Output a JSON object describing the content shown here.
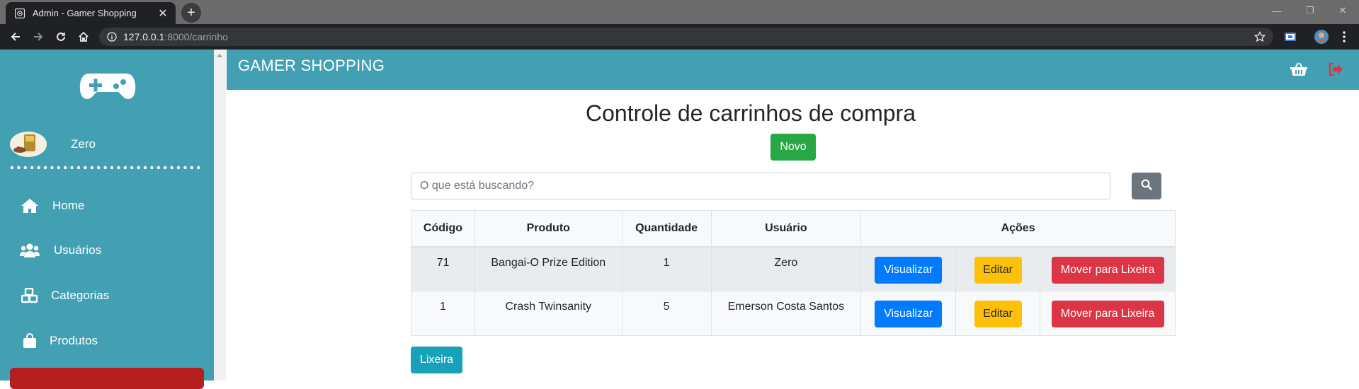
{
  "browser": {
    "tab_title": "Admin - Gamer Shopping",
    "tab_close": "✕",
    "new_tab": "+",
    "url_host": "127.0.0.1",
    "url_path": ":8000/carrinho",
    "window_controls": [
      "—",
      "❐",
      "✕"
    ]
  },
  "sidebar": {
    "logo_icon": "gamepad-icon",
    "username": "Zero",
    "items": [
      {
        "label": "Home",
        "icon": "home-icon"
      },
      {
        "label": "Usuários",
        "icon": "users-icon"
      },
      {
        "label": "Categorias",
        "icon": "categories-icon"
      },
      {
        "label": "Produtos",
        "icon": "shopping-bag-icon"
      }
    ]
  },
  "header": {
    "brand": "GAMER SHOPPING",
    "icons": [
      "basket-icon",
      "logout-icon"
    ]
  },
  "main": {
    "title": "Controle de carrinhos de compra",
    "new_button": "Novo",
    "search_placeholder": "O que está buscando?",
    "trash_button": "Lixeira",
    "table": {
      "headers": [
        "Código",
        "Produto",
        "Quantidade",
        "Usuário",
        "Ações"
      ],
      "rows": [
        {
          "codigo": "71",
          "produto": "Bangai-O Prize Edition",
          "quantidade": "1",
          "usuario": "Zero"
        },
        {
          "codigo": "1",
          "produto": "Crash Twinsanity",
          "quantidade": "5",
          "usuario": "Emerson Costa Santos"
        }
      ],
      "actions": {
        "view": "Visualizar",
        "edit": "Editar",
        "trash": "Mover para Lixeira"
      }
    }
  },
  "colors": {
    "teal": "#43a0b3",
    "green": "#28a745",
    "blue": "#007bff",
    "yellow": "#ffc107",
    "red": "#dc3545",
    "info": "#17a2b8",
    "gray": "#6c757d"
  }
}
